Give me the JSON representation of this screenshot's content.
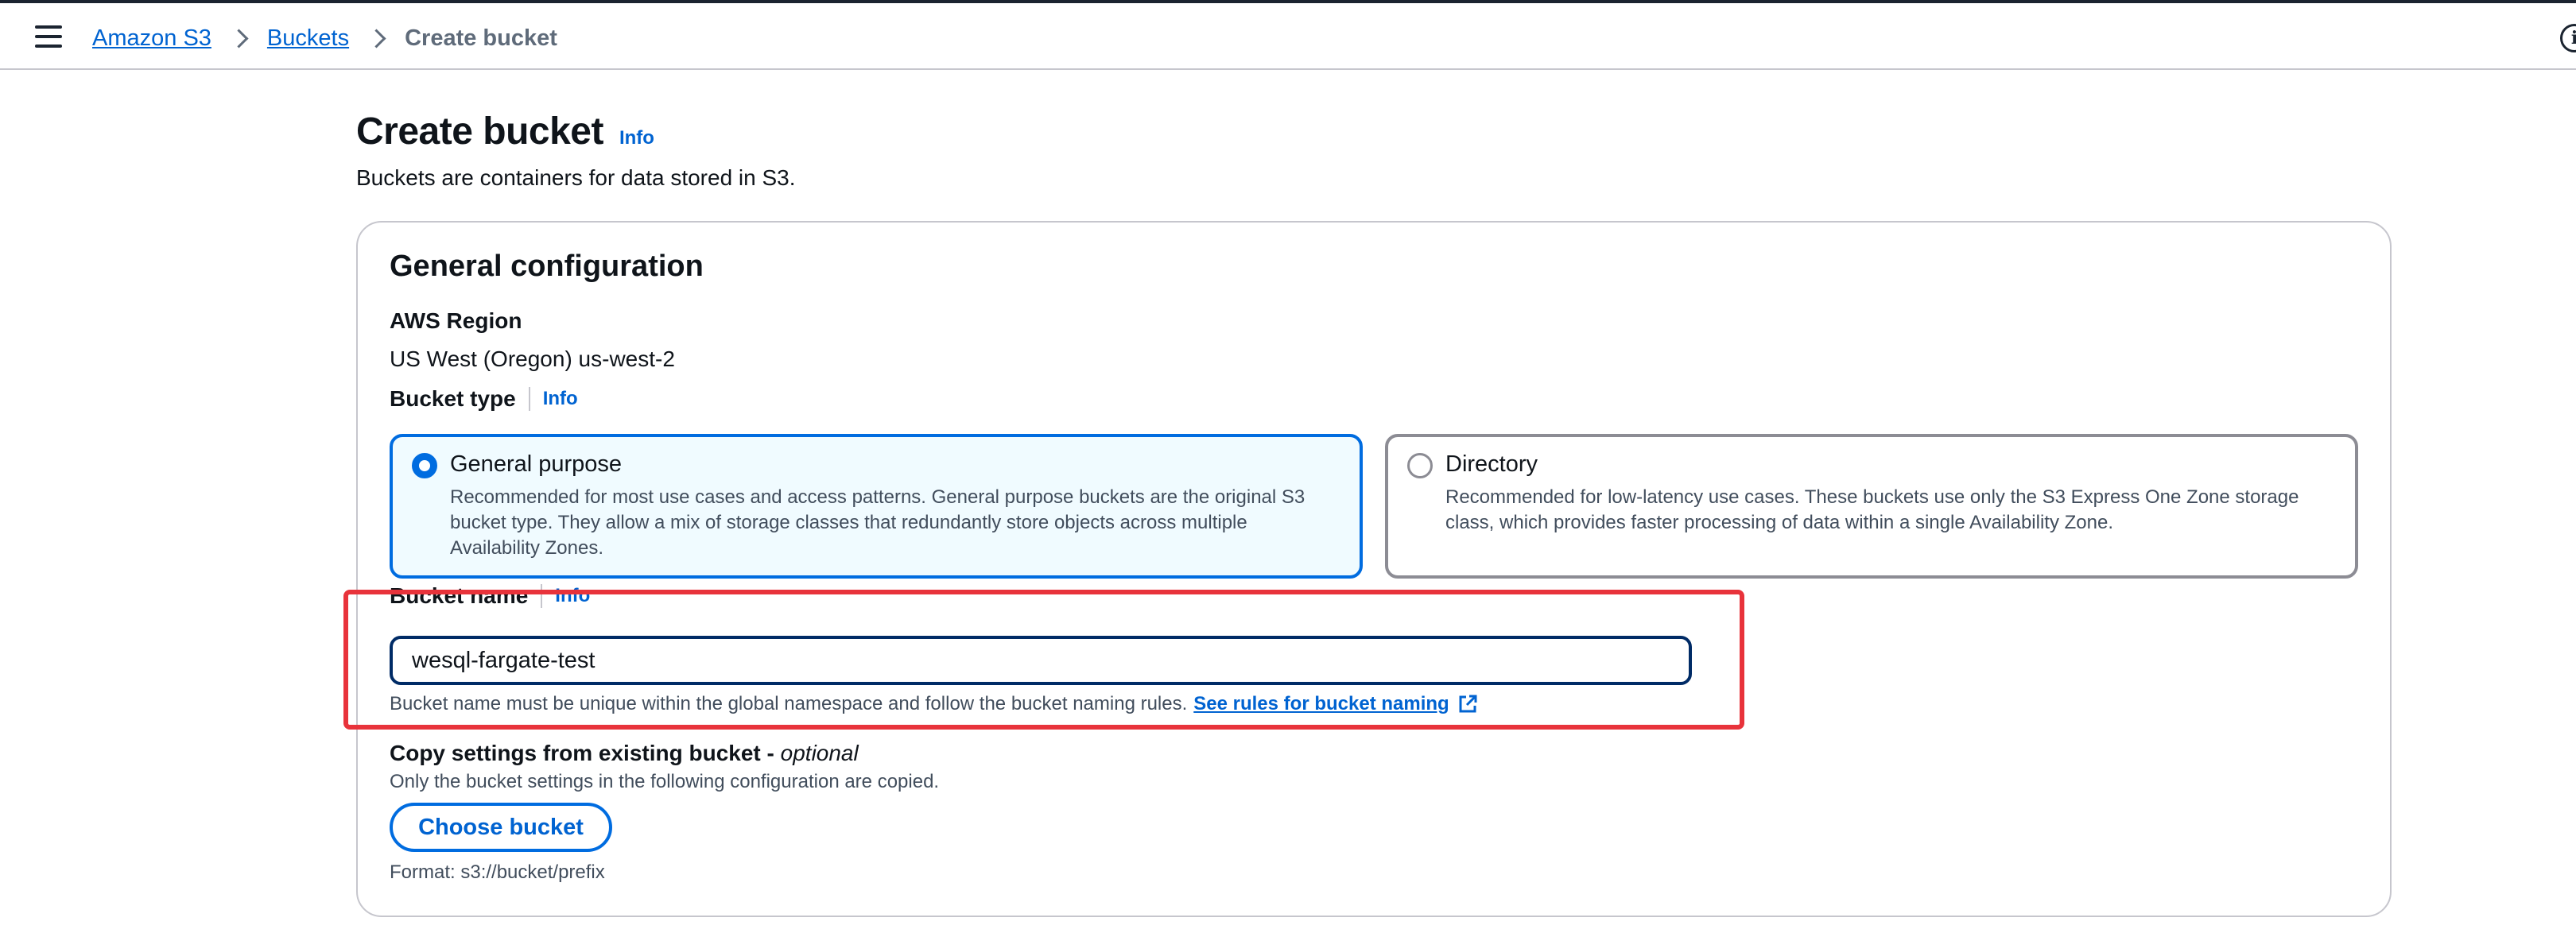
{
  "topbar": {
    "breadcrumb": {
      "root": "Amazon S3",
      "parent": "Buckets",
      "current": "Create bucket"
    },
    "info_glyph": "i"
  },
  "header": {
    "title": "Create bucket",
    "info": "Info",
    "subtitle": "Buckets are containers for data stored in S3."
  },
  "general_config": {
    "title": "General configuration",
    "region_label": "AWS Region",
    "region_value": "US West (Oregon) us-west-2",
    "bucket_type_label": "Bucket type",
    "bucket_type_info": "Info",
    "options": [
      {
        "title": "General purpose",
        "description": "Recommended for most use cases and access patterns. General purpose buckets are the original S3 bucket type. They allow a mix of storage classes that redundantly store objects across multiple Availability Zones.",
        "selected": true
      },
      {
        "title": "Directory",
        "description": "Recommended for low-latency use cases. These buckets use only the S3 Express One Zone storage class, which provides faster processing of data within a single Availability Zone.",
        "selected": false
      }
    ],
    "bucket_name_label": "Bucket name",
    "bucket_name_info": "Info",
    "bucket_name_value": "wesql-fargate-test",
    "bucket_name_constraint": "Bucket name must be unique within the global namespace and follow the bucket naming rules.",
    "naming_rules_link": "See rules for bucket naming",
    "copy_label": "Copy settings from existing bucket - ",
    "copy_optional": "optional",
    "copy_description": "Only the bucket settings in the following configuration are copied.",
    "choose_bucket_button": "Choose bucket",
    "format_hint": "Format: s3://bucket/prefix"
  },
  "colors": {
    "link": "#0063d1",
    "selected_border": "#006ce0",
    "selected_bg": "#f0fbff",
    "highlight": "#e8333b"
  }
}
